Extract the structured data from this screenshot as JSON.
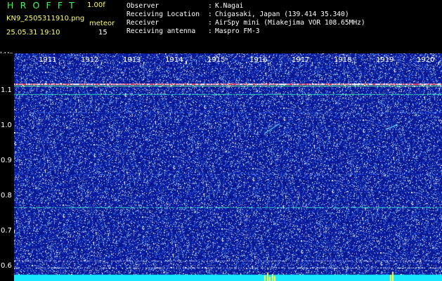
{
  "header": {
    "logo": "HROFFT",
    "version": "1.00f",
    "filename": "KN9_2505311910.png",
    "meteor_label": "meteor",
    "datetime": "25.05.31 19:10",
    "meteor_count": "15"
  },
  "info": [
    {
      "label": "Observer",
      "value": "K.Nagai"
    },
    {
      "label": "Receiving Location",
      "value": "Chigasaki, Japan (139.414 35.340)"
    },
    {
      "label": "Receiver",
      "value": "AirSpy mini (Miakejima VOR 108.65MHz)"
    },
    {
      "label": "Receiving antenna",
      "value": "Maspro FM-3"
    }
  ],
  "spectrogram": {
    "y_unit": "kHz",
    "y_ticks": [
      "1.1",
      "1.0",
      "0.9",
      "0.8",
      "0.7",
      "0.6"
    ],
    "x_ticks": [
      "1911",
      "1912",
      "1913",
      "1914",
      "1915",
      "1916",
      "1917",
      "1918",
      "1919",
      "1920"
    ],
    "colors": {
      "background": "#0a1aa0",
      "carrier": "#ff4060",
      "band": "#30e0c0",
      "floor": "#18e8ff",
      "burst": "#ffff40"
    }
  }
}
